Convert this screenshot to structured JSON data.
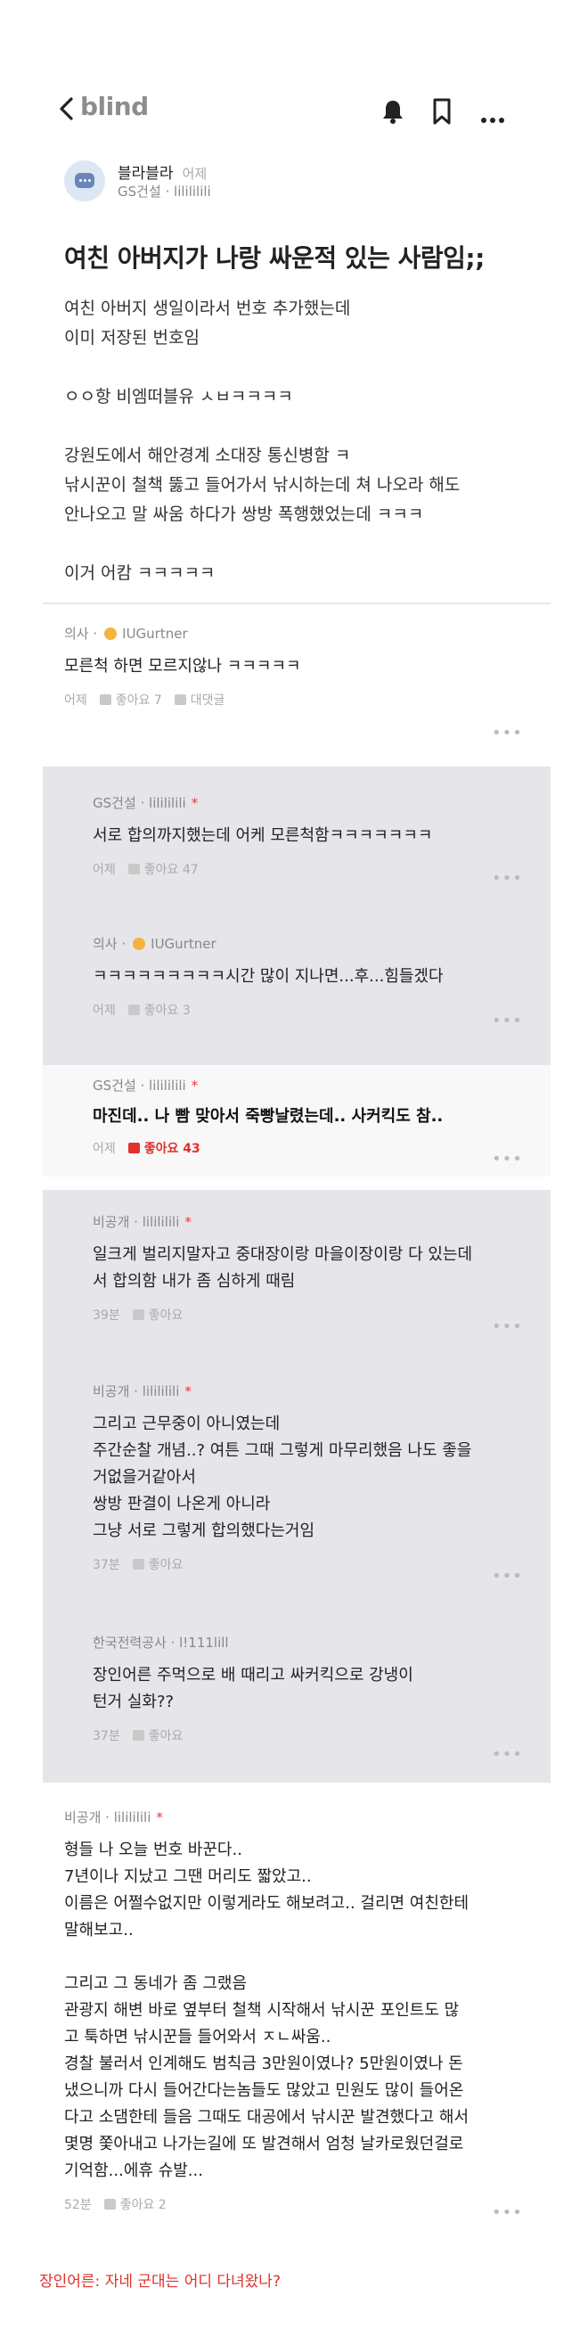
{
  "header": {
    "logo": "blind"
  },
  "post": {
    "author": "블라블라",
    "time": "어제",
    "company": "GS건설 · lilililili",
    "title": "여친 아버지가 나랑 싸운적 있는 사람임;;",
    "body": "여친 아버지 생일이라서 번호 추가했는데\n이미 저장된 번호임\n\nㅇㅇ항 비엠떠블유 ㅅㅂㅋㅋㅋㅋ\n\n강원도에서 해안경계 소대장 통신병함 ㅋ\n낚시꾼이 철책 뚫고 들어가서 낚시하는데 쳐 나오라 해도\n안나오고 말 싸움 하다가 쌍방 폭행했었는데 ㅋㅋㅋ\n\n이거 어캄 ㅋㅋㅋㅋㅋ"
  },
  "comments": [
    {
      "meta_company": "의사 ·",
      "meta_user": "IUGurtner",
      "text": "모른척 하면 모르지않나 ㅋㅋㅋㅋㅋ",
      "time": "어제",
      "likes": "좋아요 7",
      "reply": "대댓글"
    },
    {
      "meta_company": "GS건설 · lilililili",
      "star": "*",
      "text": "서로 합의까지했는데 어케 모른척함ㅋㅋㅋㅋㅋㅋㅋ",
      "time": "어제",
      "likes": "좋아요 47"
    },
    {
      "meta_company": "의사 ·",
      "meta_user": "IUGurtner",
      "text": "ㅋㅋㅋㅋㅋㅋㅋㅋㅋ시간 많이 지나면...후...힘들겠다",
      "time": "어제",
      "likes": "좋아요 3"
    },
    {
      "meta_company": "GS건설 · lilililili",
      "star": "*",
      "text": "마진데.. 나 빰 맞아서 죽빵날렸는데.. 사커킥도 참..",
      "time": "어제",
      "likes": "좋아요 43"
    },
    {
      "meta_company": "비공개 · lilililili",
      "star": "*",
      "text": "일크게 벌리지말자고 중대장이랑 마을이장이랑 다 있는데\n서 합의함 내가 좀 심하게 때림",
      "time": "39분",
      "likes": "좋아요"
    },
    {
      "meta_company": "비공개 · lilililili",
      "star": "*",
      "text": "그리고 근무중이 아니였는데\n주간순찰 개념..? 여튼 그때 그렇게 마무리했음 나도 좋을\n거없을거같아서\n쌍방 판결이 나온게 아니라\n그냥 서로 그렇게 합의했다는거임",
      "time": "37분",
      "likes": "좋아요"
    },
    {
      "meta_company": "한국전력공사 · l!111lill",
      "text": "장인어른 주먹으로 배 때리고 싸커킥으로 강냉이\n턴거 실화??",
      "time": "37분",
      "likes": "좋아요"
    },
    {
      "meta_company": "비공개 · lilililili",
      "star": "*",
      "text": "형들 나 오늘 번호 바꾼다..\n7년이나 지났고 그땐 머리도 짧았고..\n이름은 어쩔수없지만 이렇게라도 해보려고.. 걸리면 여친한테\n말해보고..\n\n그리고 그 동네가 좀 그랬음\n관광지 해변 바로 옆부터 철책 시작해서 낚시꾼 포인트도 많\n고 툭하면 낚시꾼들 들어와서 ㅈㄴ싸움..\n경찰 불러서 인계해도 범칙금 3만원이였나? 5만원이였나 돈\n냈으니까 다시 들어간다는놈들도 많았고 민원도 많이 들어온\n다고 소댐한테 들음 그때도 대공에서 낚시꾼 발견했다고 해서\n몇명 쫓아내고 나가는길에 또 발견해서 엄청 날카로웠던걸로\n기억함...에휴 슈발...",
      "time": "52분",
      "likes": "좋아요 2"
    }
  ],
  "caption": "장인어른: 자네 군대는 어디 다녀왔나?",
  "colors": {
    "accent_red": "#e0312c",
    "panel_gray": "#e6e6ea",
    "logo_gray": "#8d8d8d"
  }
}
